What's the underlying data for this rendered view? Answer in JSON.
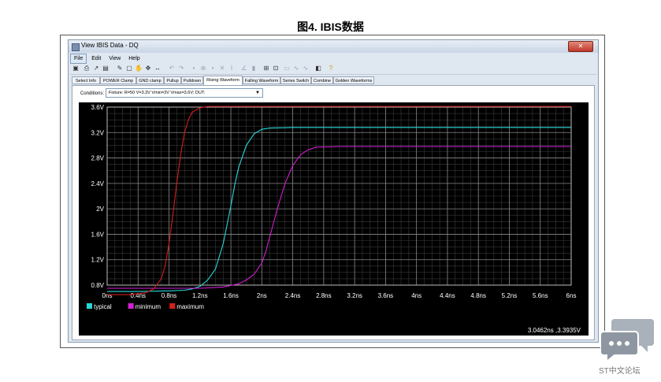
{
  "figure_title": "图4. IBIS数据",
  "window": {
    "title": "View IBIS Data - DQ",
    "close_glyph": "✕"
  },
  "menu": [
    "File",
    "Edit",
    "View",
    "Help"
  ],
  "tabs": [
    "Select Info",
    "POWER Clamp",
    "GND clamp",
    "Pullup",
    "Pulldown",
    "Rising Waveform",
    "Falling Waveform",
    "Series Switch",
    "Combine",
    "Golden Waveforms"
  ],
  "selected_tab": "Rising Waveform",
  "conditions": {
    "label": "Conditions:",
    "value": "Fixture: R=50 V=3.3V Vmin=3V Vmax=3.6V; DUT:"
  },
  "status_readout": "3.0462ns ,3.3935V",
  "watermark": "ST中文论坛",
  "colors": {
    "typical": "#27d8d8",
    "minimum": "#d41ed4",
    "maximum": "#d41e1e",
    "grid": "#8a8a8a"
  },
  "chart_data": {
    "type": "line",
    "x_ticks": [
      "0ns",
      "0.4ns",
      "0.8ns",
      "1.2ns",
      "1.6ns",
      "2ns",
      "2.4ns",
      "2.8ns",
      "3.2ns",
      "3.6ns",
      "4ns",
      "4.4ns",
      "4.8ns",
      "5.2ns",
      "5.6ns",
      "6ns"
    ],
    "y_ticks": [
      "0.8V",
      "1.2V",
      "1.6V",
      "2V",
      "2.4V",
      "2.8V",
      "3.2V",
      "3.6V"
    ],
    "xlim": [
      0,
      6
    ],
    "ylim": [
      0.8,
      3.6
    ],
    "grid": true,
    "legend_position": "bottom-left",
    "series": [
      {
        "name": "typical",
        "color": "#27d8d8",
        "x": [
          0,
          0.4,
          0.8,
          1.0,
          1.1,
          1.2,
          1.3,
          1.4,
          1.5,
          1.55,
          1.6,
          1.65,
          1.7,
          1.8,
          1.9,
          2.0,
          2.1,
          2.4,
          3.0,
          4.0,
          5.0,
          6.0
        ],
        "y": [
          0.7,
          0.7,
          0.71,
          0.72,
          0.74,
          0.78,
          0.88,
          1.05,
          1.45,
          1.75,
          2.05,
          2.38,
          2.65,
          3.0,
          3.18,
          3.25,
          3.27,
          3.28,
          3.28,
          3.28,
          3.28,
          3.28
        ]
      },
      {
        "name": "minimum",
        "color": "#d41ed4",
        "x": [
          0,
          0.4,
          0.8,
          1.2,
          1.5,
          1.7,
          1.8,
          1.9,
          2.0,
          2.05,
          2.1,
          2.2,
          2.3,
          2.4,
          2.5,
          2.6,
          2.7,
          3.0,
          3.5,
          6.0
        ],
        "y": [
          0.75,
          0.75,
          0.75,
          0.75,
          0.77,
          0.82,
          0.88,
          0.97,
          1.15,
          1.32,
          1.55,
          2.0,
          2.4,
          2.68,
          2.85,
          2.93,
          2.97,
          2.98,
          2.98,
          2.98
        ]
      },
      {
        "name": "maximum",
        "color": "#d41e1e",
        "x": [
          0,
          0.3,
          0.5,
          0.6,
          0.7,
          0.75,
          0.8,
          0.85,
          0.9,
          0.95,
          1.0,
          1.05,
          1.1,
          1.2,
          1.3,
          1.5,
          2.0,
          3.0,
          6.0
        ],
        "y": [
          0.65,
          0.65,
          0.68,
          0.74,
          0.9,
          1.1,
          1.45,
          1.9,
          2.4,
          2.85,
          3.2,
          3.4,
          3.52,
          3.59,
          3.61,
          3.61,
          3.61,
          3.61,
          3.61
        ]
      }
    ]
  }
}
